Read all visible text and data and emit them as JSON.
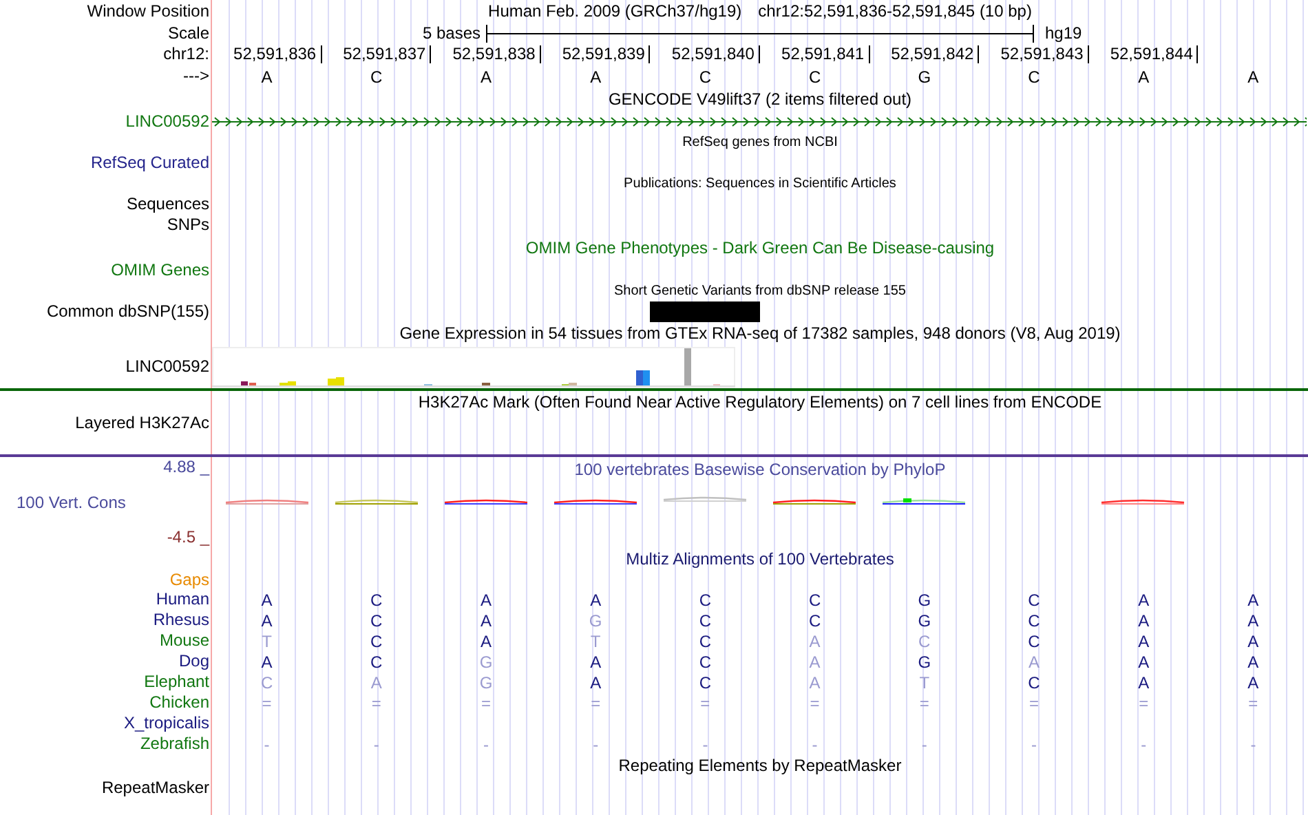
{
  "header": {
    "label": "Window Position",
    "assembly": "Human Feb. 2009 (GRCh37/hg19)",
    "position": "chr12:52,591,836-52,591,845 (10 bp)"
  },
  "scale": {
    "label": "Scale",
    "size": "5 bases",
    "assembly": "hg19"
  },
  "coordinates": {
    "label": "chr12:",
    "positions": [
      "52,591,836",
      "52,591,837",
      "52,591,838",
      "52,591,839",
      "52,591,840",
      "52,591,841",
      "52,591,842",
      "52,591,843",
      "52,591,844"
    ]
  },
  "bases": {
    "label": "--->",
    "letters": [
      "A",
      "C",
      "A",
      "A",
      "C",
      "C",
      "G",
      "C",
      "A",
      "A"
    ]
  },
  "tracks": [
    {
      "kind": "gene",
      "title": {
        "text": "GENCODE V49lift37 (2 items filtered out)",
        "color": "#000000"
      },
      "labels": [
        {
          "text": "LINC00592",
          "color": "#117711"
        }
      ]
    },
    {
      "kind": "collapsed",
      "title": {
        "text": "RefSeq genes from NCBI",
        "color": "#000000"
      },
      "labels": [
        {
          "text": "RefSeq Curated",
          "color": "#24248c"
        }
      ]
    },
    {
      "kind": "collapsed",
      "title": {
        "text": "Publications: Sequences in Scientific Articles",
        "color": "#000000"
      },
      "labels": [
        {
          "text": "Sequences",
          "color": "#000000"
        },
        {
          "text": "SNPs",
          "color": "#000000"
        }
      ]
    },
    {
      "kind": "phenotype",
      "title": {
        "text": "OMIM Gene Phenotypes - Dark Green Can Be Disease-causing",
        "color": "#117711"
      },
      "labels": [
        {
          "text": "OMIM Genes",
          "color": "#117711"
        }
      ]
    },
    {
      "kind": "snp",
      "title": {
        "text": "Short Genetic Variants from dbSNP release 155",
        "color": "#000000"
      },
      "labels": [
        {
          "text": "Common dbSNP(155)",
          "color": "#000000"
        }
      ],
      "variants": [
        false,
        false,
        false,
        false,
        true,
        false,
        false,
        false,
        false,
        false
      ]
    },
    {
      "kind": "expression",
      "title": {
        "text": "Gene Expression in 54 tissues from GTEx RNA-seq of 17382 samples, 948 donors (V8, Aug 2019)",
        "color": "#000000"
      },
      "labels": [
        {
          "text": "LINC00592",
          "color": "#000000"
        }
      ]
    },
    {
      "kind": "signal",
      "title": {
        "text": "H3K27Ac Mark (Often Found Near Active Regulatory Elements) on 7 cell lines from ENCODE",
        "color": "#000000"
      },
      "labels": [
        {
          "text": "Layered H3K27Ac",
          "color": "#000000"
        }
      ]
    },
    {
      "kind": "conservation",
      "title": {
        "text": "100 vertebrates Basewise Conservation by PhyloP",
        "color": "#4a4a9c"
      },
      "labels": [
        {
          "text": "100 Vert. Cons",
          "color": "#4a4a9c"
        }
      ],
      "max_label": "4.88 _",
      "min_label": "-4.5 _"
    },
    {
      "kind": "alignment",
      "title": {
        "text": "Multiz Alignments of 100 Vertebrates",
        "color": "#1a1a70"
      },
      "gaps_label": "Gaps",
      "species": [
        {
          "name": "Human",
          "color": "#1a1a80",
          "cells": [
            {
              "base": "A",
              "match": true
            },
            {
              "base": "C",
              "match": true
            },
            {
              "base": "A",
              "match": true
            },
            {
              "base": "A",
              "match": true
            },
            {
              "base": "C",
              "match": true
            },
            {
              "base": "C",
              "match": true
            },
            {
              "base": "G",
              "match": true
            },
            {
              "base": "C",
              "match": true
            },
            {
              "base": "A",
              "match": true
            },
            {
              "base": "A",
              "match": true
            }
          ]
        },
        {
          "name": "Rhesus",
          "color": "#1a1a80",
          "cells": [
            {
              "base": "A",
              "match": true
            },
            {
              "base": "C",
              "match": true
            },
            {
              "base": "A",
              "match": true
            },
            {
              "base": "G",
              "match": false
            },
            {
              "base": "C",
              "match": true
            },
            {
              "base": "C",
              "match": true
            },
            {
              "base": "G",
              "match": true
            },
            {
              "base": "C",
              "match": true
            },
            {
              "base": "A",
              "match": true
            },
            {
              "base": "A",
              "match": true
            }
          ]
        },
        {
          "name": "Mouse",
          "color": "#117711",
          "cells": [
            {
              "base": "T",
              "match": false
            },
            {
              "base": "C",
              "match": true
            },
            {
              "base": "A",
              "match": true
            },
            {
              "base": "T",
              "match": false
            },
            {
              "base": "C",
              "match": true
            },
            {
              "base": "A",
              "match": false
            },
            {
              "base": "C",
              "match": false
            },
            {
              "base": "C",
              "match": true
            },
            {
              "base": "A",
              "match": true
            },
            {
              "base": "A",
              "match": true
            }
          ]
        },
        {
          "name": "Dog",
          "color": "#1a1a80",
          "cells": [
            {
              "base": "A",
              "match": true
            },
            {
              "base": "C",
              "match": true
            },
            {
              "base": "G",
              "match": false
            },
            {
              "base": "A",
              "match": true
            },
            {
              "base": "C",
              "match": true
            },
            {
              "base": "A",
              "match": false
            },
            {
              "base": "G",
              "match": true
            },
            {
              "base": "A",
              "match": false
            },
            {
              "base": "A",
              "match": true
            },
            {
              "base": "A",
              "match": true
            }
          ]
        },
        {
          "name": "Elephant",
          "color": "#117711",
          "cells": [
            {
              "base": "C",
              "match": false
            },
            {
              "base": "A",
              "match": false
            },
            {
              "base": "G",
              "match": false
            },
            {
              "base": "A",
              "match": true
            },
            {
              "base": "C",
              "match": true
            },
            {
              "base": "A",
              "match": false
            },
            {
              "base": "T",
              "match": false
            },
            {
              "base": "C",
              "match": true
            },
            {
              "base": "A",
              "match": true
            },
            {
              "base": "A",
              "match": true
            }
          ]
        },
        {
          "name": "Chicken",
          "color": "#117711",
          "cells": [
            {
              "base": "=",
              "match": false
            },
            {
              "base": "=",
              "match": false
            },
            {
              "base": "=",
              "match": false
            },
            {
              "base": "=",
              "match": false
            },
            {
              "base": "=",
              "match": false
            },
            {
              "base": "=",
              "match": false
            },
            {
              "base": "=",
              "match": false
            },
            {
              "base": "=",
              "match": false
            },
            {
              "base": "=",
              "match": false
            },
            {
              "base": "=",
              "match": false
            }
          ]
        },
        {
          "name": "X_tropicalis",
          "color": "#1a1a80"
        },
        {
          "name": "Zebrafish",
          "color": "#117711",
          "cells": [
            {
              "base": "-",
              "match": false
            },
            {
              "base": "-",
              "match": false
            },
            {
              "base": "-",
              "match": false
            },
            {
              "base": "-",
              "match": false
            },
            {
              "base": "-",
              "match": false
            },
            {
              "base": "-",
              "match": false
            },
            {
              "base": "-",
              "match": false
            },
            {
              "base": "-",
              "match": false
            },
            {
              "base": "-",
              "match": false
            },
            {
              "base": "-",
              "match": false
            }
          ]
        }
      ]
    },
    {
      "kind": "repeat",
      "title": {
        "text": "Repeating Elements by RepeatMasker",
        "color": "#000000"
      },
      "labels": [
        {
          "text": "RepeatMasker",
          "color": "#000000"
        }
      ]
    }
  ]
}
